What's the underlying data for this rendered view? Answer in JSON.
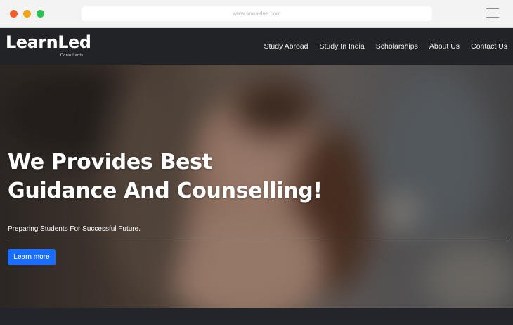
{
  "browser": {
    "url": "www.sneaklae.com"
  },
  "site": {
    "logo_main": "LearnLed",
    "logo_sub": "Consultants",
    "nav": [
      {
        "label": "Study Abroad"
      },
      {
        "label": "Study In India"
      },
      {
        "label": "Scholarships"
      },
      {
        "label": "About Us"
      },
      {
        "label": "Contact Us"
      }
    ]
  },
  "hero": {
    "heading_line1": "We Provides Best",
    "heading_line2": "Guidance And Counselling!",
    "subtitle": "Preparing Students For Successful Future.",
    "cta_label": "Learn more"
  },
  "colors": {
    "nav_bg": "#222327",
    "cta": "#1a6dff"
  }
}
